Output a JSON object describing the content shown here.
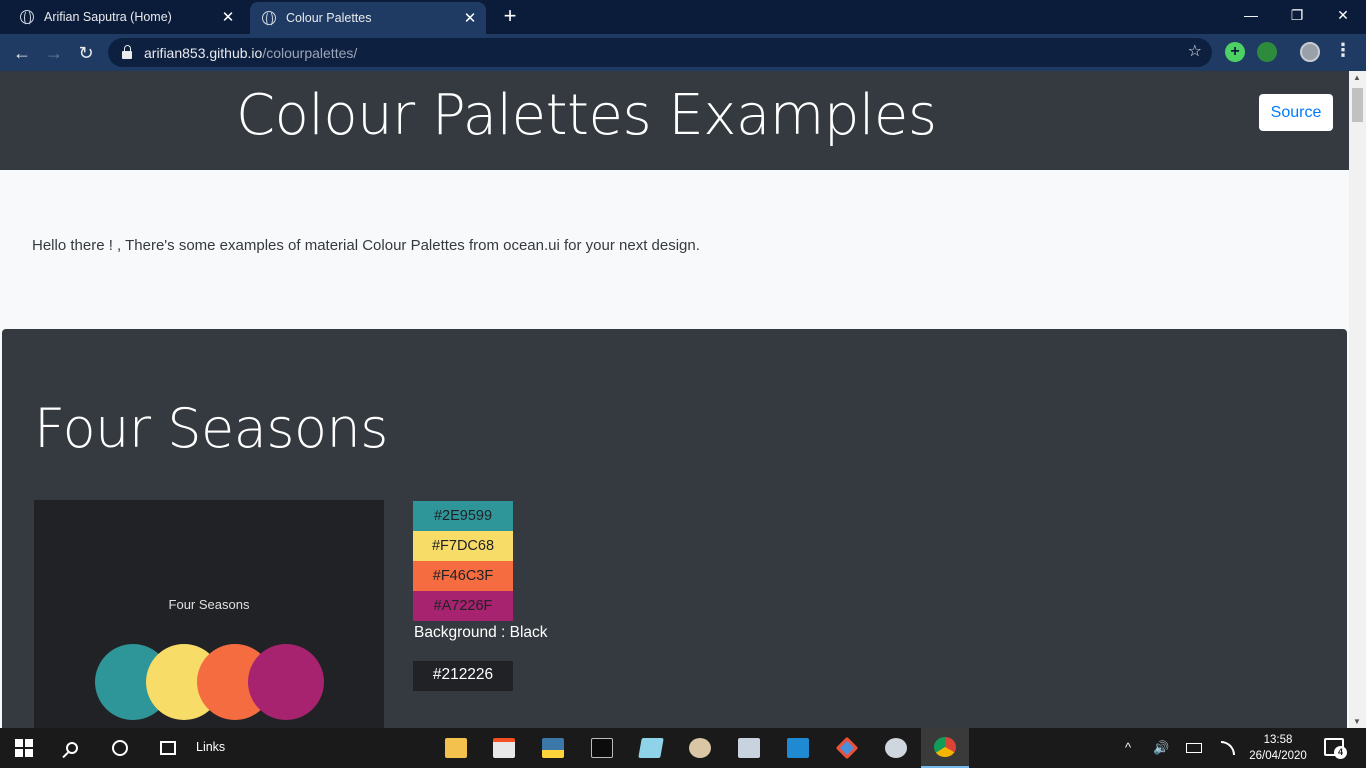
{
  "browser": {
    "tabs": [
      {
        "title": "Arifian Saputra (Home)",
        "close": "✕"
      },
      {
        "title": "Colour Palettes",
        "close": "✕"
      }
    ],
    "new_tab": "+",
    "window_controls": {
      "minimize": "—",
      "restore": "❐",
      "close": "✕"
    },
    "nav": {
      "back": "←",
      "forward": "→",
      "reload": "↻"
    },
    "url_host": "arifian853.github.io",
    "url_path": "/colourpalettes/",
    "bookmark_icon": "☆",
    "extensions": {
      "plus": "+"
    },
    "menu": "⋮"
  },
  "page": {
    "title": "Colour Palettes Examples",
    "source_button": "Source",
    "intro": "Hello there ! , There's some examples of material Colour Palettes from ocean.ui for your next design.",
    "palette": {
      "name": "Four Seasons",
      "preview_label": "Four Seasons",
      "colors": [
        {
          "hex": "#2E9599",
          "value": "#2E9599"
        },
        {
          "hex": "#F7DC68",
          "value": "#F7DC68"
        },
        {
          "hex": "#F46C3F",
          "value": "#F46C3F"
        },
        {
          "hex": "#A7226F",
          "value": "#A7226F"
        }
      ],
      "background_label": "Background : Black",
      "background_hex": "#212226"
    }
  },
  "taskbar": {
    "links_label": "Links",
    "clock_time": "13:58",
    "clock_date": "26/04/2020",
    "notification_count": "4",
    "tray_up": "^",
    "tray_volume": "🔊"
  },
  "colors": {
    "header_bg": "#343a40",
    "page_bg": "#f8f9fa",
    "link_blue": "#007bff"
  }
}
